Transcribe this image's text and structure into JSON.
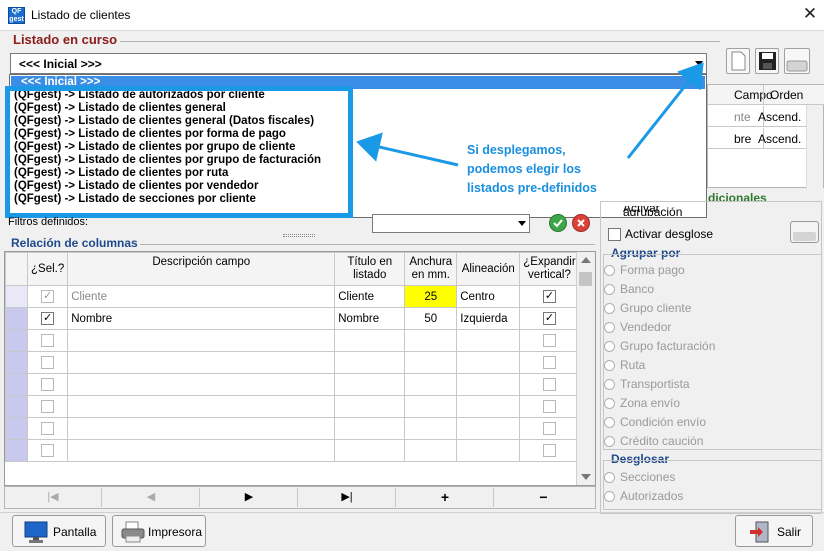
{
  "window": {
    "title": "Listado de clientes",
    "app_icon": "QFgest",
    "close_glyph": "✕"
  },
  "listado": {
    "section_title": "Listado en curso",
    "combo_value": "<<< Inicial >>>",
    "dropdown_items": [
      "<<< Inicial >>>",
      "(QFgest) -> Listado de autorizados por cliente",
      "(QFgest) -> Listado de clientes general",
      "(QFgest) -> Listado de clientes general (Datos fiscales)",
      "(QFgest) -> Listado de clientes por forma de pago",
      "(QFgest) -> Listado de clientes por grupo de cliente",
      "(QFgest) -> Listado de clientes por grupo de facturación",
      "(QFgest) -> Listado de clientes por ruta",
      "(QFgest) -> Listado de clientes por vendedor",
      "(QFgest) -> Listado de secciones por cliente"
    ]
  },
  "annotation": {
    "lines": [
      "Si desplegamos,",
      "podemos elegir los",
      "listados pre-definidos"
    ],
    "color": "#1a8fe0"
  },
  "orden_grid": {
    "headers": [
      "Campo",
      "Orden"
    ],
    "rows": [
      [
        "nte",
        "Ascend."
      ],
      [
        "bre",
        "Ascend."
      ]
    ]
  },
  "filtros": {
    "label": "Filtros definidos:"
  },
  "columnas": {
    "section_title": "Relación de columnas",
    "headers": [
      "¿Sel.?",
      "Descripción campo",
      "Título en listado",
      "Anchura en mm.",
      "Alineación",
      "¿Expandir vertical?"
    ],
    "rows": [
      {
        "sel": "✓",
        "sel_disabled": true,
        "desc": "Cliente",
        "titulo": "Cliente",
        "anchura": "25",
        "alineacion": "Centro",
        "expandir": "✓"
      },
      {
        "sel": "✓",
        "sel_disabled": false,
        "desc": "Nombre",
        "titulo": "Nombre",
        "anchura": "50",
        "alineacion": "Izquierda",
        "expandir": "✓"
      },
      {
        "sel": "",
        "desc": "",
        "titulo": "",
        "anchura": "",
        "alineacion": "",
        "expandir": ""
      },
      {
        "sel": "",
        "desc": "",
        "titulo": "",
        "anchura": "",
        "alineacion": "",
        "expandir": ""
      },
      {
        "sel": "",
        "desc": "",
        "titulo": "",
        "anchura": "",
        "alineacion": "",
        "expandir": ""
      },
      {
        "sel": "",
        "desc": "",
        "titulo": "",
        "anchura": "",
        "alineacion": "",
        "expandir": ""
      },
      {
        "sel": "",
        "desc": "",
        "titulo": "",
        "anchura": "",
        "alineacion": "",
        "expandir": ""
      },
      {
        "sel": "",
        "desc": "",
        "titulo": "",
        "anchura": "",
        "alineacion": "",
        "expandir": ""
      }
    ],
    "nav": [
      "|◀",
      "◀",
      "▶",
      "▶|",
      "+",
      "−"
    ]
  },
  "opciones": {
    "title_partial": "dicionales",
    "activar_agrupacion": "Activar agrupación",
    "activar_desglose": "Activar desglose",
    "agrupar_title": "Agrupar por",
    "agrupar_items": [
      "Forma pago",
      "Banco",
      "Grupo cliente",
      "Vendedor",
      "Grupo facturación",
      "Ruta",
      "Transportista",
      "Zona envío",
      "Condición envío",
      "Crédito caución"
    ],
    "desglosar_title": "Desglosar",
    "desglosar_items": [
      "Secciones",
      "Autorizados"
    ]
  },
  "buttons": {
    "pantalla": "Pantalla",
    "impresora": "Impresora",
    "salir": "Salir"
  }
}
